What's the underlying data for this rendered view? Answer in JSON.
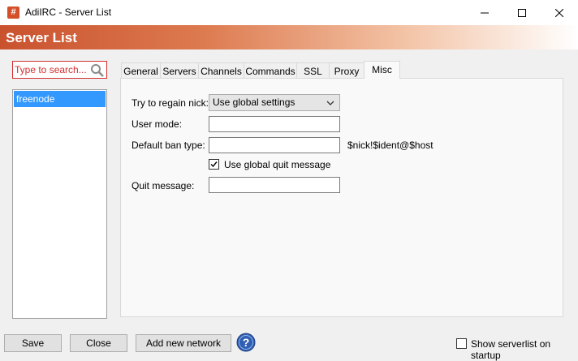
{
  "window": {
    "title": "AdiIRC - Server List",
    "app_icon_glyph": "#",
    "accent": "#d4502a"
  },
  "banner": {
    "title": "Server List"
  },
  "search": {
    "placeholder": "Type to search..."
  },
  "servers": [
    {
      "name": "freenode",
      "selected": true
    }
  ],
  "tabs": [
    {
      "label": "General",
      "active": false
    },
    {
      "label": "Servers",
      "active": false
    },
    {
      "label": "Channels",
      "active": false
    },
    {
      "label": "Commands",
      "active": false
    },
    {
      "label": "SSL",
      "active": false
    },
    {
      "label": "Proxy",
      "active": false
    },
    {
      "label": "Misc",
      "active": true
    }
  ],
  "misc": {
    "regain_nick_label": "Try to regain nick:",
    "regain_nick_value": "Use global settings",
    "user_mode_label": "User mode:",
    "user_mode_value": "",
    "ban_type_label": "Default ban type:",
    "ban_type_value": "",
    "ban_type_hint": "$nick!$ident@$host",
    "global_quit_label": "Use global quit message",
    "global_quit_checked": true,
    "quit_message_label": "Quit message:",
    "quit_message_value": ""
  },
  "footer": {
    "save_label": "Save",
    "close_label": "Close",
    "add_network_label": "Add new network",
    "show_on_startup_label": "Show serverlist on startup",
    "show_on_startup_checked": false
  }
}
